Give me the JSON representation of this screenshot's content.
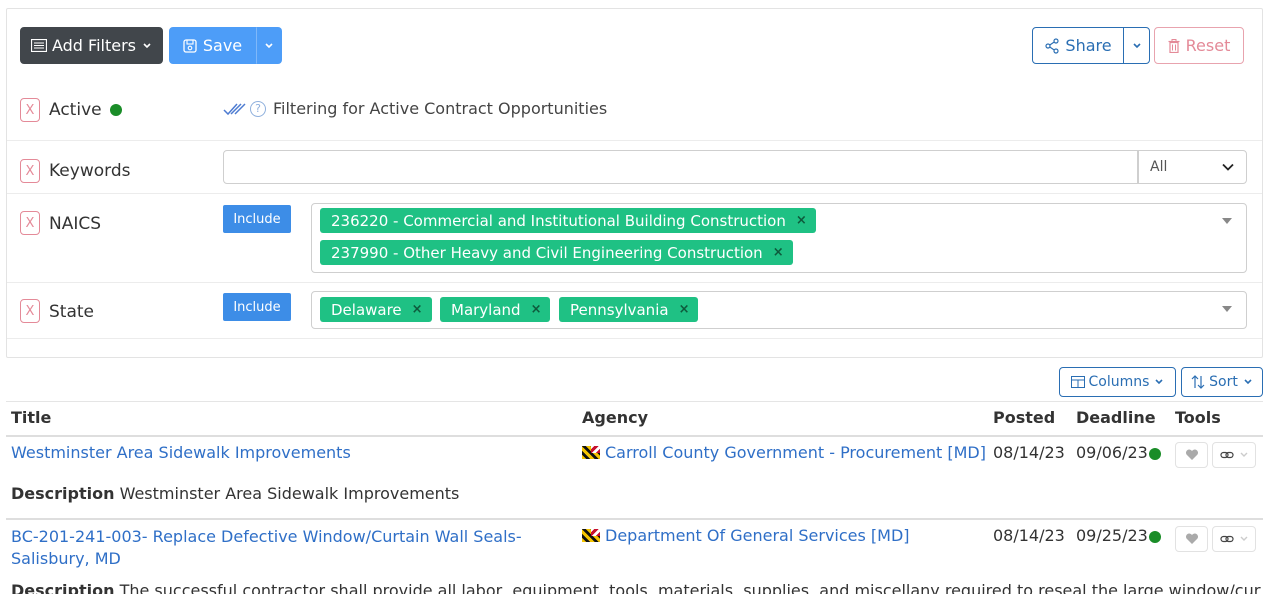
{
  "toolbar": {
    "add_filters_label": "Add Filters",
    "save_label": "Save",
    "share_label": "Share",
    "reset_label": "Reset"
  },
  "filters": {
    "remove_label": "X",
    "active": {
      "label": "Active",
      "description": "Filtering for Active Contract Opportunities"
    },
    "keywords": {
      "label": "Keywords",
      "value": "",
      "scope": "All"
    },
    "naics": {
      "label": "NAICS",
      "mode": "Include",
      "tags": [
        "236220 - Commercial and Institutional Building Construction",
        "237990 - Other Heavy and Civil Engineering Construction"
      ]
    },
    "state": {
      "label": "State",
      "mode": "Include",
      "tags": [
        "Delaware",
        "Maryland",
        "Pennsylvania"
      ]
    },
    "tag_remove": "×"
  },
  "table": {
    "columns_button": "Columns",
    "sort_button": "Sort",
    "headers": {
      "title": "Title",
      "agency": "Agency",
      "posted": "Posted",
      "deadline": "Deadline",
      "tools": "Tools"
    },
    "description_label": "Description",
    "rows": [
      {
        "title": "Westminster Area Sidewalk Improvements",
        "agency": "Carroll County Government - Procurement [MD]",
        "posted": "08/14/23",
        "deadline": "09/06/23",
        "description": "Westminster Area Sidewalk Improvements"
      },
      {
        "title_line1": "BC-201-241-003- Replace Defective Window/Curtain Wall Seals-",
        "title_line2": "Salisbury, MD",
        "agency": "Department Of General Services [MD]",
        "posted": "08/14/23",
        "deadline": "09/25/23",
        "description": "The successful contractor shall provide all labor, equipment, tools, materials, supplies, and miscellany required to reseal the large window/curtain"
      }
    ]
  },
  "colors": {
    "primary": "#4d9df8",
    "dark": "#41464b",
    "tag_green": "#1fc184",
    "status_green": "#1a8d28",
    "danger": "#e48a98",
    "link": "#2f6fc7"
  }
}
